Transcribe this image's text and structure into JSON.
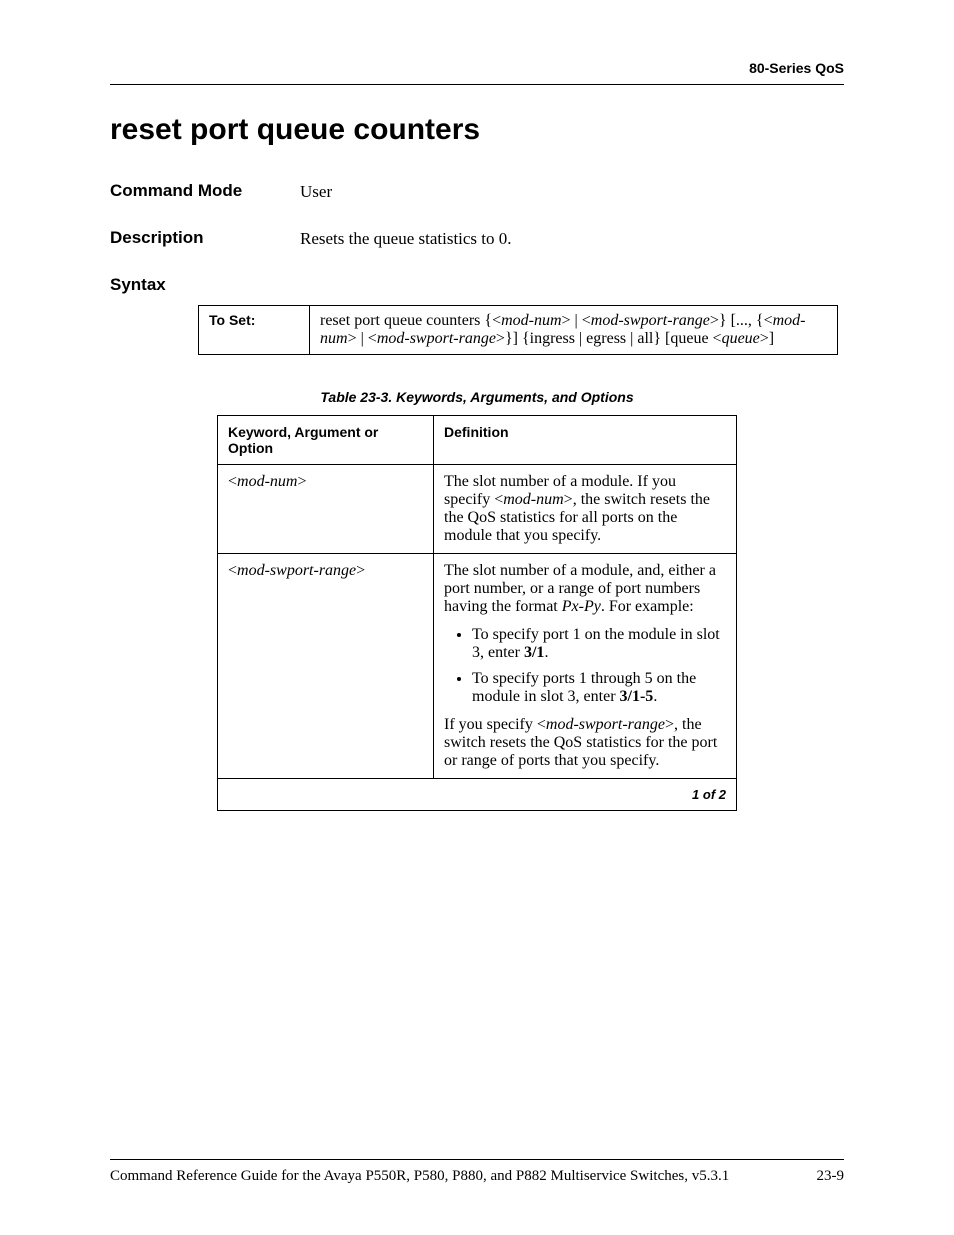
{
  "header": {
    "sectionLabel": "80-Series QoS"
  },
  "title": "reset port queue counters",
  "commandMode": {
    "label": "Command Mode",
    "value": "User"
  },
  "description": {
    "label": "Description",
    "value": "Resets the queue statistics to 0."
  },
  "syntax": {
    "label": "Syntax",
    "toSet": {
      "label": "To Set:",
      "part1": "reset port queue counters {<",
      "i1": "mod-num",
      "part2": "> | <",
      "i2": "mod-swport-range",
      "part3": ">} [..., {<",
      "i3": "mod-num",
      "part4": "> | <",
      "i4": "mod-swport-range",
      "part5": ">}] {ingress | egress | all} [queue <",
      "i5": "queue",
      "part6": ">]"
    }
  },
  "tableCaption": "Table 23-3.  Keywords, Arguments, and Options",
  "tableHeaders": {
    "kw": "Keyword, Argument or Option",
    "def": "Definition"
  },
  "rows": {
    "r1": {
      "kwOpen": "<",
      "kwItalic": "mod-num",
      "kwClose": ">",
      "def_a": "The slot number of a module. If you specify <",
      "def_i": "mod-num",
      "def_b": ">, the switch resets the the QoS statistics for all ports on the module that you specify."
    },
    "r2": {
      "kwOpen": "<",
      "kwItalic": "mod-swport-range",
      "kwClose": ">",
      "p1a": "The slot number of a module, and, either a port number, or a range of port numbers having the format ",
      "p1i": "Px-Py",
      "p1b": ". For example:",
      "b1a": "To specify port 1 on the module in slot 3, enter ",
      "b1bold": "3/1",
      "b1b": ".",
      "b2a": "To specify ports 1 through 5 on the module in slot 3, enter ",
      "b2bold": "3/1-5",
      "b2b": ".",
      "p2a": "If you specify <",
      "p2i": "mod-swport-range",
      "p2b": ">, the switch resets the QoS statistics for the port or range of ports that you specify."
    }
  },
  "pager": "1 of 2",
  "footer": {
    "left": "Command Reference Guide for the Avaya P550R, P580, P880, and P882 Multiservice Switches, v5.3.1",
    "right": "23-9"
  }
}
